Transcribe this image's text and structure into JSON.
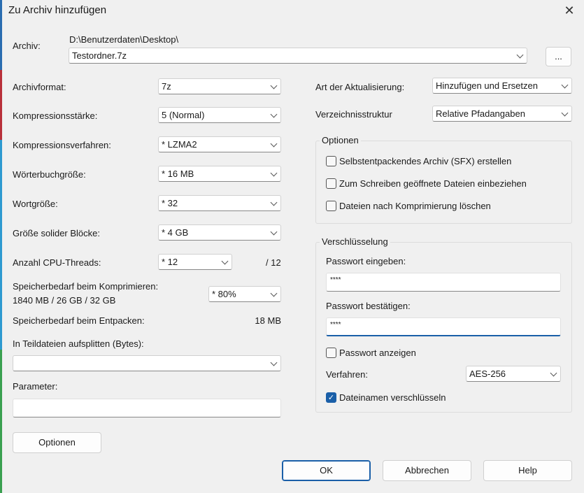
{
  "title": "Zu Archiv hinzufügen",
  "archive": {
    "label": "Archiv:",
    "path": "D:\\Benutzerdaten\\Desktop\\",
    "filename": "Testordner.7z",
    "browse_label": "..."
  },
  "left": {
    "format": {
      "label": "Archivformat:",
      "value": "7z"
    },
    "level": {
      "label": "Kompressionsstärke:",
      "value": "5 (Normal)"
    },
    "method": {
      "label": "Kompressionsverfahren:",
      "value": "* LZMA2"
    },
    "dict": {
      "label": "Wörterbuchgröße:",
      "value": "* 16 MB"
    },
    "word": {
      "label": "Wortgröße:",
      "value": "* 32"
    },
    "solid": {
      "label": "Größe solider Blöcke:",
      "value": "* 4 GB"
    },
    "threads": {
      "label": "Anzahl CPU-Threads:",
      "value": "* 12",
      "max": "/ 12"
    },
    "mem_comp": {
      "label": "Speicherbedarf beim Komprimieren:",
      "detail": "1840 MB / 26 GB / 32 GB",
      "value": "* 80%"
    },
    "mem_decomp": {
      "label": "Speicherbedarf beim Entpacken:",
      "value": "18 MB"
    },
    "split": {
      "label": "In Teildateien aufsplitten (Bytes):",
      "value": ""
    },
    "params": {
      "label": "Parameter:",
      "value": ""
    },
    "options_button": "Optionen"
  },
  "right": {
    "update": {
      "label": "Art der Aktualisierung:",
      "value": "Hinzufügen und Ersetzen"
    },
    "paths": {
      "label": "Verzeichnisstruktur",
      "value": "Relative Pfadangaben"
    },
    "options": {
      "title": "Optionen",
      "items": [
        {
          "label": "Selbstentpackendes Archiv (SFX) erstellen",
          "checked": false
        },
        {
          "label": "Zum Schreiben geöffnete Dateien einbeziehen",
          "checked": false
        },
        {
          "label": "Dateien nach Komprimierung löschen",
          "checked": false
        }
      ]
    },
    "encryption": {
      "title": "Verschlüsselung",
      "pw_label": "Passwort eingeben:",
      "pw_value": "****",
      "pw2_label": "Passwort bestätigen:",
      "pw2_value": "****",
      "show_pw": "Passwort anzeigen",
      "method_label": "Verfahren:",
      "method_value": "AES-256",
      "encrypt_names": "Dateinamen verschlüsseln"
    }
  },
  "buttons": {
    "ok": "OK",
    "cancel": "Abbrechen",
    "help": "Help"
  }
}
